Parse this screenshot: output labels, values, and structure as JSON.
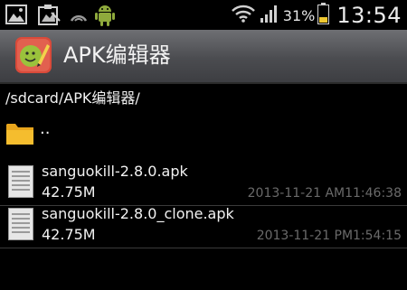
{
  "status_bar": {
    "icons": [
      "gallery-icon",
      "screenshot-icon",
      "data-sync-icon",
      "android-icon",
      "wifi-icon",
      "signal-icon",
      "battery-icon"
    ],
    "battery_percent": "31%",
    "time": "13:54",
    "battery_color": "#f0c830"
  },
  "app": {
    "title": "APK编辑器",
    "accent": "#d94a3a"
  },
  "browser": {
    "path": "/sdcard/APK编辑器/",
    "parent_label": ".."
  },
  "files": [
    {
      "name": "sanguokill-2.8.0.apk",
      "size": "42.75M",
      "date": "2013-11-21 AM11:46:38"
    },
    {
      "name": "sanguokill-2.8.0_clone.apk",
      "size": "42.75M",
      "date": "2013-11-21 PM1:54:15"
    }
  ]
}
